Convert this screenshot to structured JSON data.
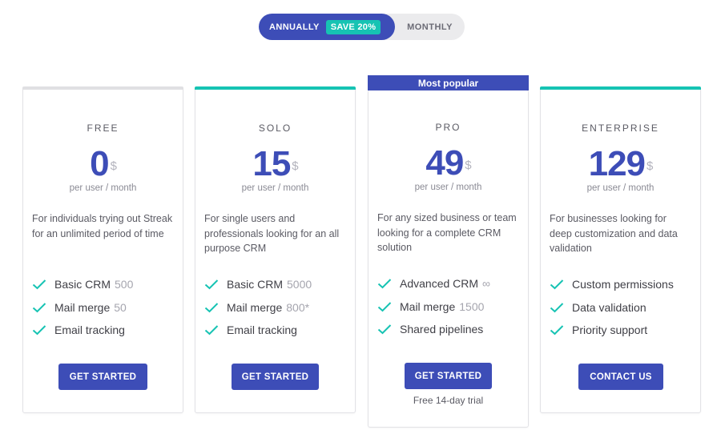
{
  "billing_toggle": {
    "annually_label": "ANNUALLY",
    "save_badge": "SAVE 20%",
    "monthly_label": "MONTHLY",
    "selected": "annually"
  },
  "colors": {
    "accent": "#3d4db7",
    "teal": "#16c3b3",
    "free_topbar": "#e0e0e3"
  },
  "plans": [
    {
      "name": "FREE",
      "price": "0",
      "currency": "$",
      "period": "per user / month",
      "description": "For individuals trying out Streak for an unlimited period of time",
      "features": [
        {
          "label": "Basic CRM",
          "value": "500"
        },
        {
          "label": "Mail merge",
          "value": "50"
        },
        {
          "label": "Email tracking",
          "value": ""
        }
      ],
      "cta": "GET STARTED"
    },
    {
      "name": "SOLO",
      "price": "15",
      "currency": "$",
      "period": "per user / month",
      "description": "For single users and professionals looking for an all purpose CRM",
      "features": [
        {
          "label": "Basic CRM",
          "value": "5000"
        },
        {
          "label": "Mail merge",
          "value": "800*"
        },
        {
          "label": "Email tracking",
          "value": ""
        }
      ],
      "cta": "GET STARTED"
    },
    {
      "name": "PRO",
      "badge": "Most popular",
      "price": "49",
      "currency": "$",
      "period": "per user / month",
      "description": "For any sized business or team looking for a complete CRM solution",
      "features": [
        {
          "label": "Advanced CRM",
          "value": "∞"
        },
        {
          "label": "Mail merge",
          "value": "1500"
        },
        {
          "label": "Shared pipelines",
          "value": ""
        }
      ],
      "cta": "GET STARTED",
      "note": "Free 14-day trial"
    },
    {
      "name": "ENTERPRISE",
      "price": "129",
      "currency": "$",
      "period": "per user / month",
      "description": "For businesses looking for deep customization and data validation",
      "features": [
        {
          "label": "Custom permissions",
          "value": ""
        },
        {
          "label": "Data validation",
          "value": ""
        },
        {
          "label": "Priority support",
          "value": ""
        }
      ],
      "cta": "CONTACT US"
    }
  ]
}
